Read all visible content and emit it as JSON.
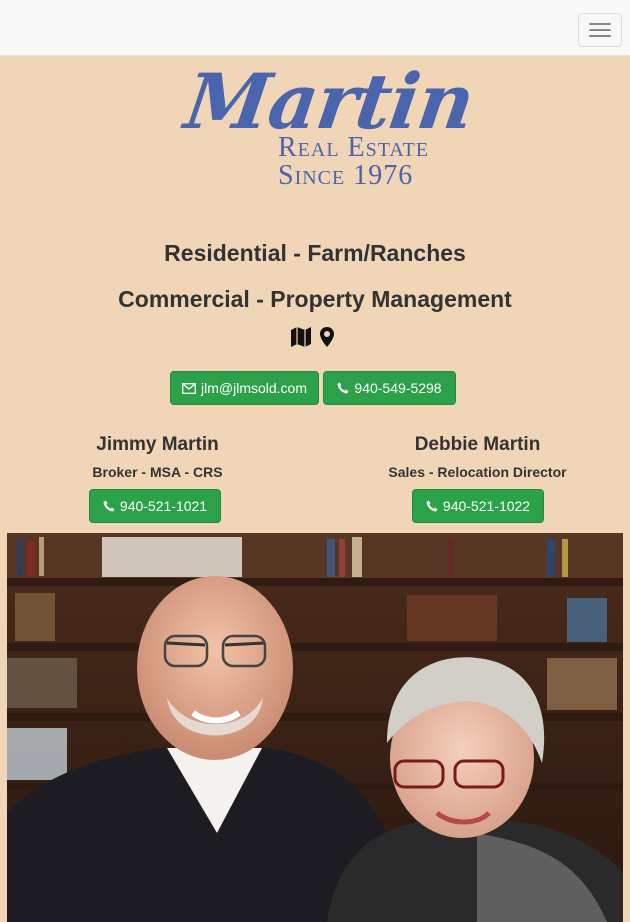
{
  "nav": {
    "menu_icon": "hamburger-icon"
  },
  "logo": {
    "word": "Martin",
    "line1": "Real Estate",
    "line2": "Since 1976"
  },
  "taglines": {
    "line1": "Residential - Farm/Ranches",
    "line2": "Commercial - Property Management"
  },
  "icons": {
    "map": "map-icon",
    "pin": "map-marker-icon"
  },
  "contact": {
    "email": "jlm@jlmsold.com",
    "office_phone": "940-549-5298"
  },
  "agents": [
    {
      "name": "Jimmy Martin",
      "role": "Broker - MSA - CRS",
      "phone": "940-521-1021"
    },
    {
      "name": "Debbie Martin",
      "role": "Sales - Relocation Director",
      "phone": "940-521-1022"
    }
  ],
  "colors": {
    "background": "#f0d6b7",
    "accent_green": "#2ba24a",
    "logo_blue": "#4a64ad",
    "navbar": "#f8f8f8"
  }
}
